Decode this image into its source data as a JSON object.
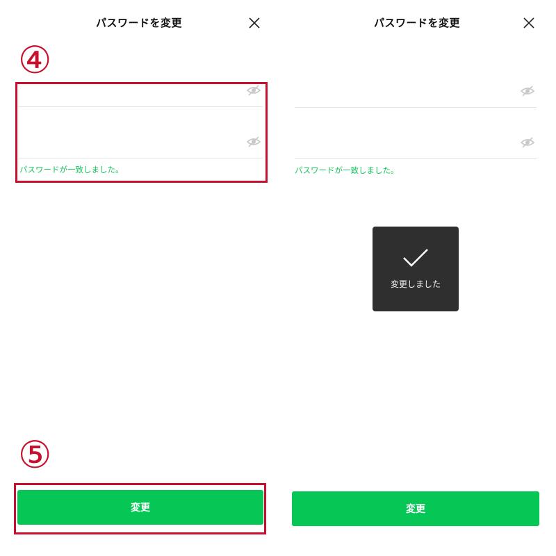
{
  "left_screen": {
    "title": "パスワードを変更",
    "close_icon": "close-icon",
    "password_field_icon": "eye-off-icon",
    "confirm_field_icon": "eye-off-icon",
    "match_message": "パスワードが一致しました。",
    "submit_label": "変更",
    "annotation_step_fields": "④",
    "annotation_step_button": "⑤"
  },
  "right_screen": {
    "title": "パスワードを変更",
    "close_icon": "close-icon",
    "password_field_icon": "eye-off-icon",
    "confirm_field_icon": "eye-off-icon",
    "match_message": "パスワードが一致しました。",
    "toast_icon": "checkmark-icon",
    "toast_message": "変更しました",
    "submit_label": "変更"
  },
  "colors": {
    "primary_green": "#06c755",
    "success_text": "#17c45b",
    "annotation_red": "#c8102e",
    "toast_bg": "#2f2f2f"
  }
}
